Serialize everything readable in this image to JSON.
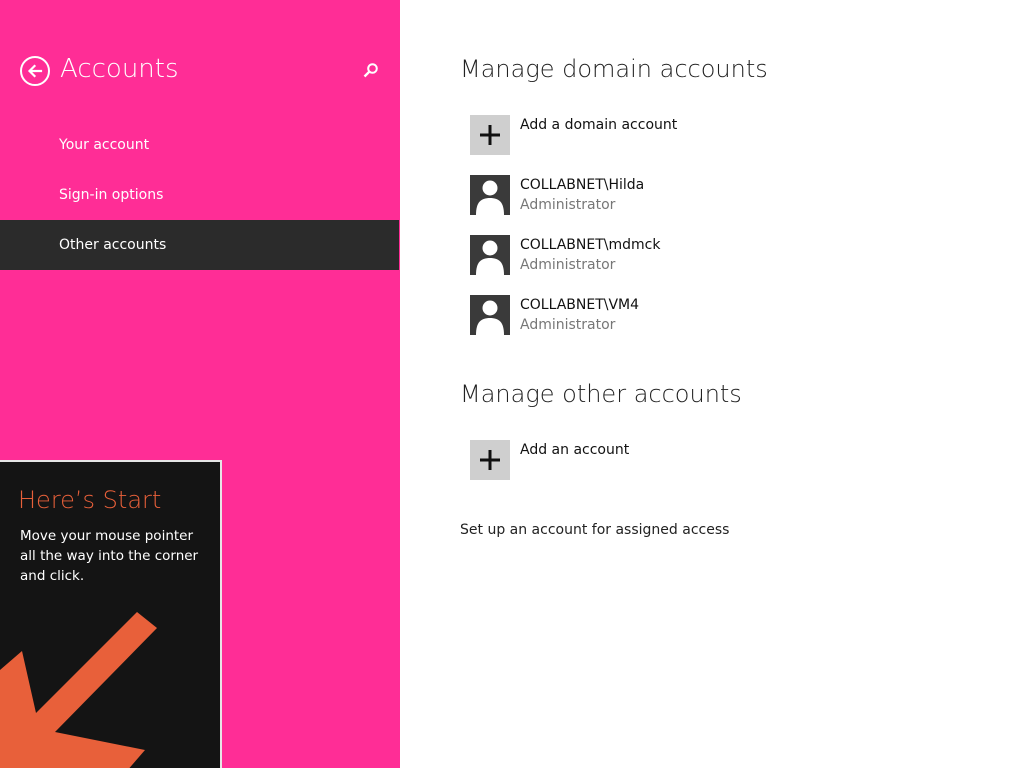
{
  "sidebar": {
    "title": "Accounts",
    "back_icon": "back-arrow-icon",
    "search_icon": "search-icon",
    "items": [
      {
        "label": "Your account"
      },
      {
        "label": "Sign-in options"
      },
      {
        "label": "Other accounts",
        "selected": true
      }
    ],
    "background_color": "#ff2d96"
  },
  "tip": {
    "title": "Here’s Start",
    "text": "Move your mouse pointer all the way into the corner and click.",
    "arrow_icon": "corner-arrow-icon",
    "accent_color": "#e8603a"
  },
  "main": {
    "domain_section": {
      "title": "Manage domain accounts",
      "add_label": "Add a domain account",
      "accounts": [
        {
          "name": "COLLABNET\\Hilda",
          "role": "Administrator"
        },
        {
          "name": "COLLABNET\\mdmck",
          "role": "Administrator"
        },
        {
          "name": "COLLABNET\\VM4",
          "role": "Administrator"
        }
      ]
    },
    "other_section": {
      "title": "Manage other accounts",
      "add_label": "Add an account"
    },
    "assigned_access_link": "Set up an account for assigned access"
  }
}
